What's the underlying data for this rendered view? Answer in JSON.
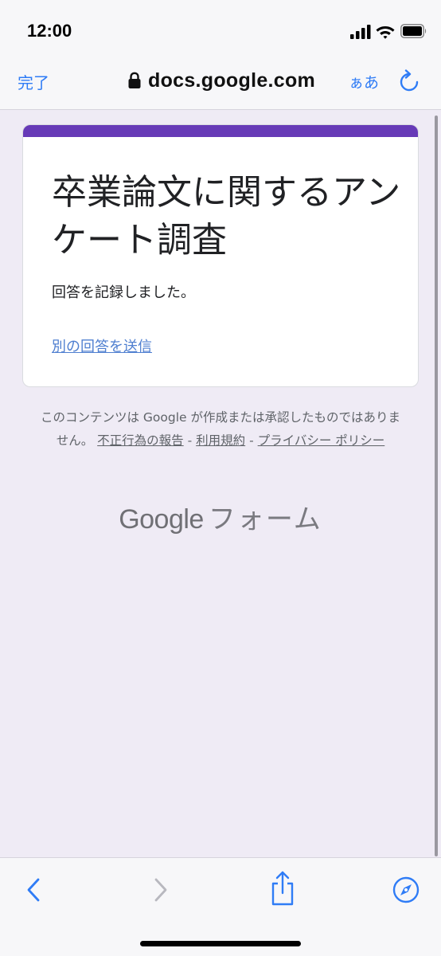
{
  "status_bar": {
    "time": "12:00"
  },
  "browser": {
    "done_label": "完了",
    "url": "docs.google.com",
    "text_size_label": "ぁあ"
  },
  "form": {
    "title": "卒業論文に関するアンケート調査",
    "confirmation": "回答を記録しました。",
    "submit_another": "別の回答を送信",
    "accent_color": "#673ab7"
  },
  "disclaimer": {
    "text": "このコンテンツは Google が作成または承認したものではありません。",
    "links": [
      {
        "label": "不正行為の報告"
      },
      {
        "label": "利用規約"
      },
      {
        "label": "プライバシー ポリシー"
      }
    ],
    "separator": "-"
  },
  "footer": {
    "brand": "Google",
    "product": "フォーム"
  },
  "toolbar": {
    "icons": [
      "back-icon",
      "forward-icon",
      "share-icon",
      "compass-icon"
    ]
  }
}
